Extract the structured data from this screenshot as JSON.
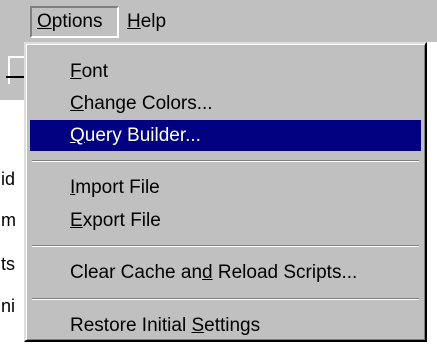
{
  "menubar": {
    "options": {
      "label": "Options",
      "mnemonic": "O"
    },
    "help": {
      "label": "Help",
      "mnemonic": "H"
    }
  },
  "menu": {
    "items": [
      {
        "label": "Font",
        "mnemonic_index": 0,
        "highlighted": false
      },
      {
        "label": "Change Colors...",
        "mnemonic_index": 0,
        "highlighted": false
      },
      {
        "label": "Query Builder...",
        "mnemonic_index": 0,
        "highlighted": true
      },
      {
        "label": "Import File",
        "mnemonic_index": 0,
        "highlighted": false
      },
      {
        "label": "Export File",
        "mnemonic_index": 0,
        "highlighted": false
      },
      {
        "label": "Clear Cache and Reload Scripts...",
        "mnemonic_index": 14,
        "highlighted": false
      },
      {
        "label": "Restore Initial Settings",
        "mnemonic_index": 16,
        "highlighted": false
      }
    ]
  },
  "background": {
    "fragments": [
      "id",
      "m",
      "ts",
      "ni"
    ]
  },
  "colors": {
    "menu_face": "#c0c0c0",
    "highlight": "#000080",
    "highlight_text": "#ffffff"
  }
}
